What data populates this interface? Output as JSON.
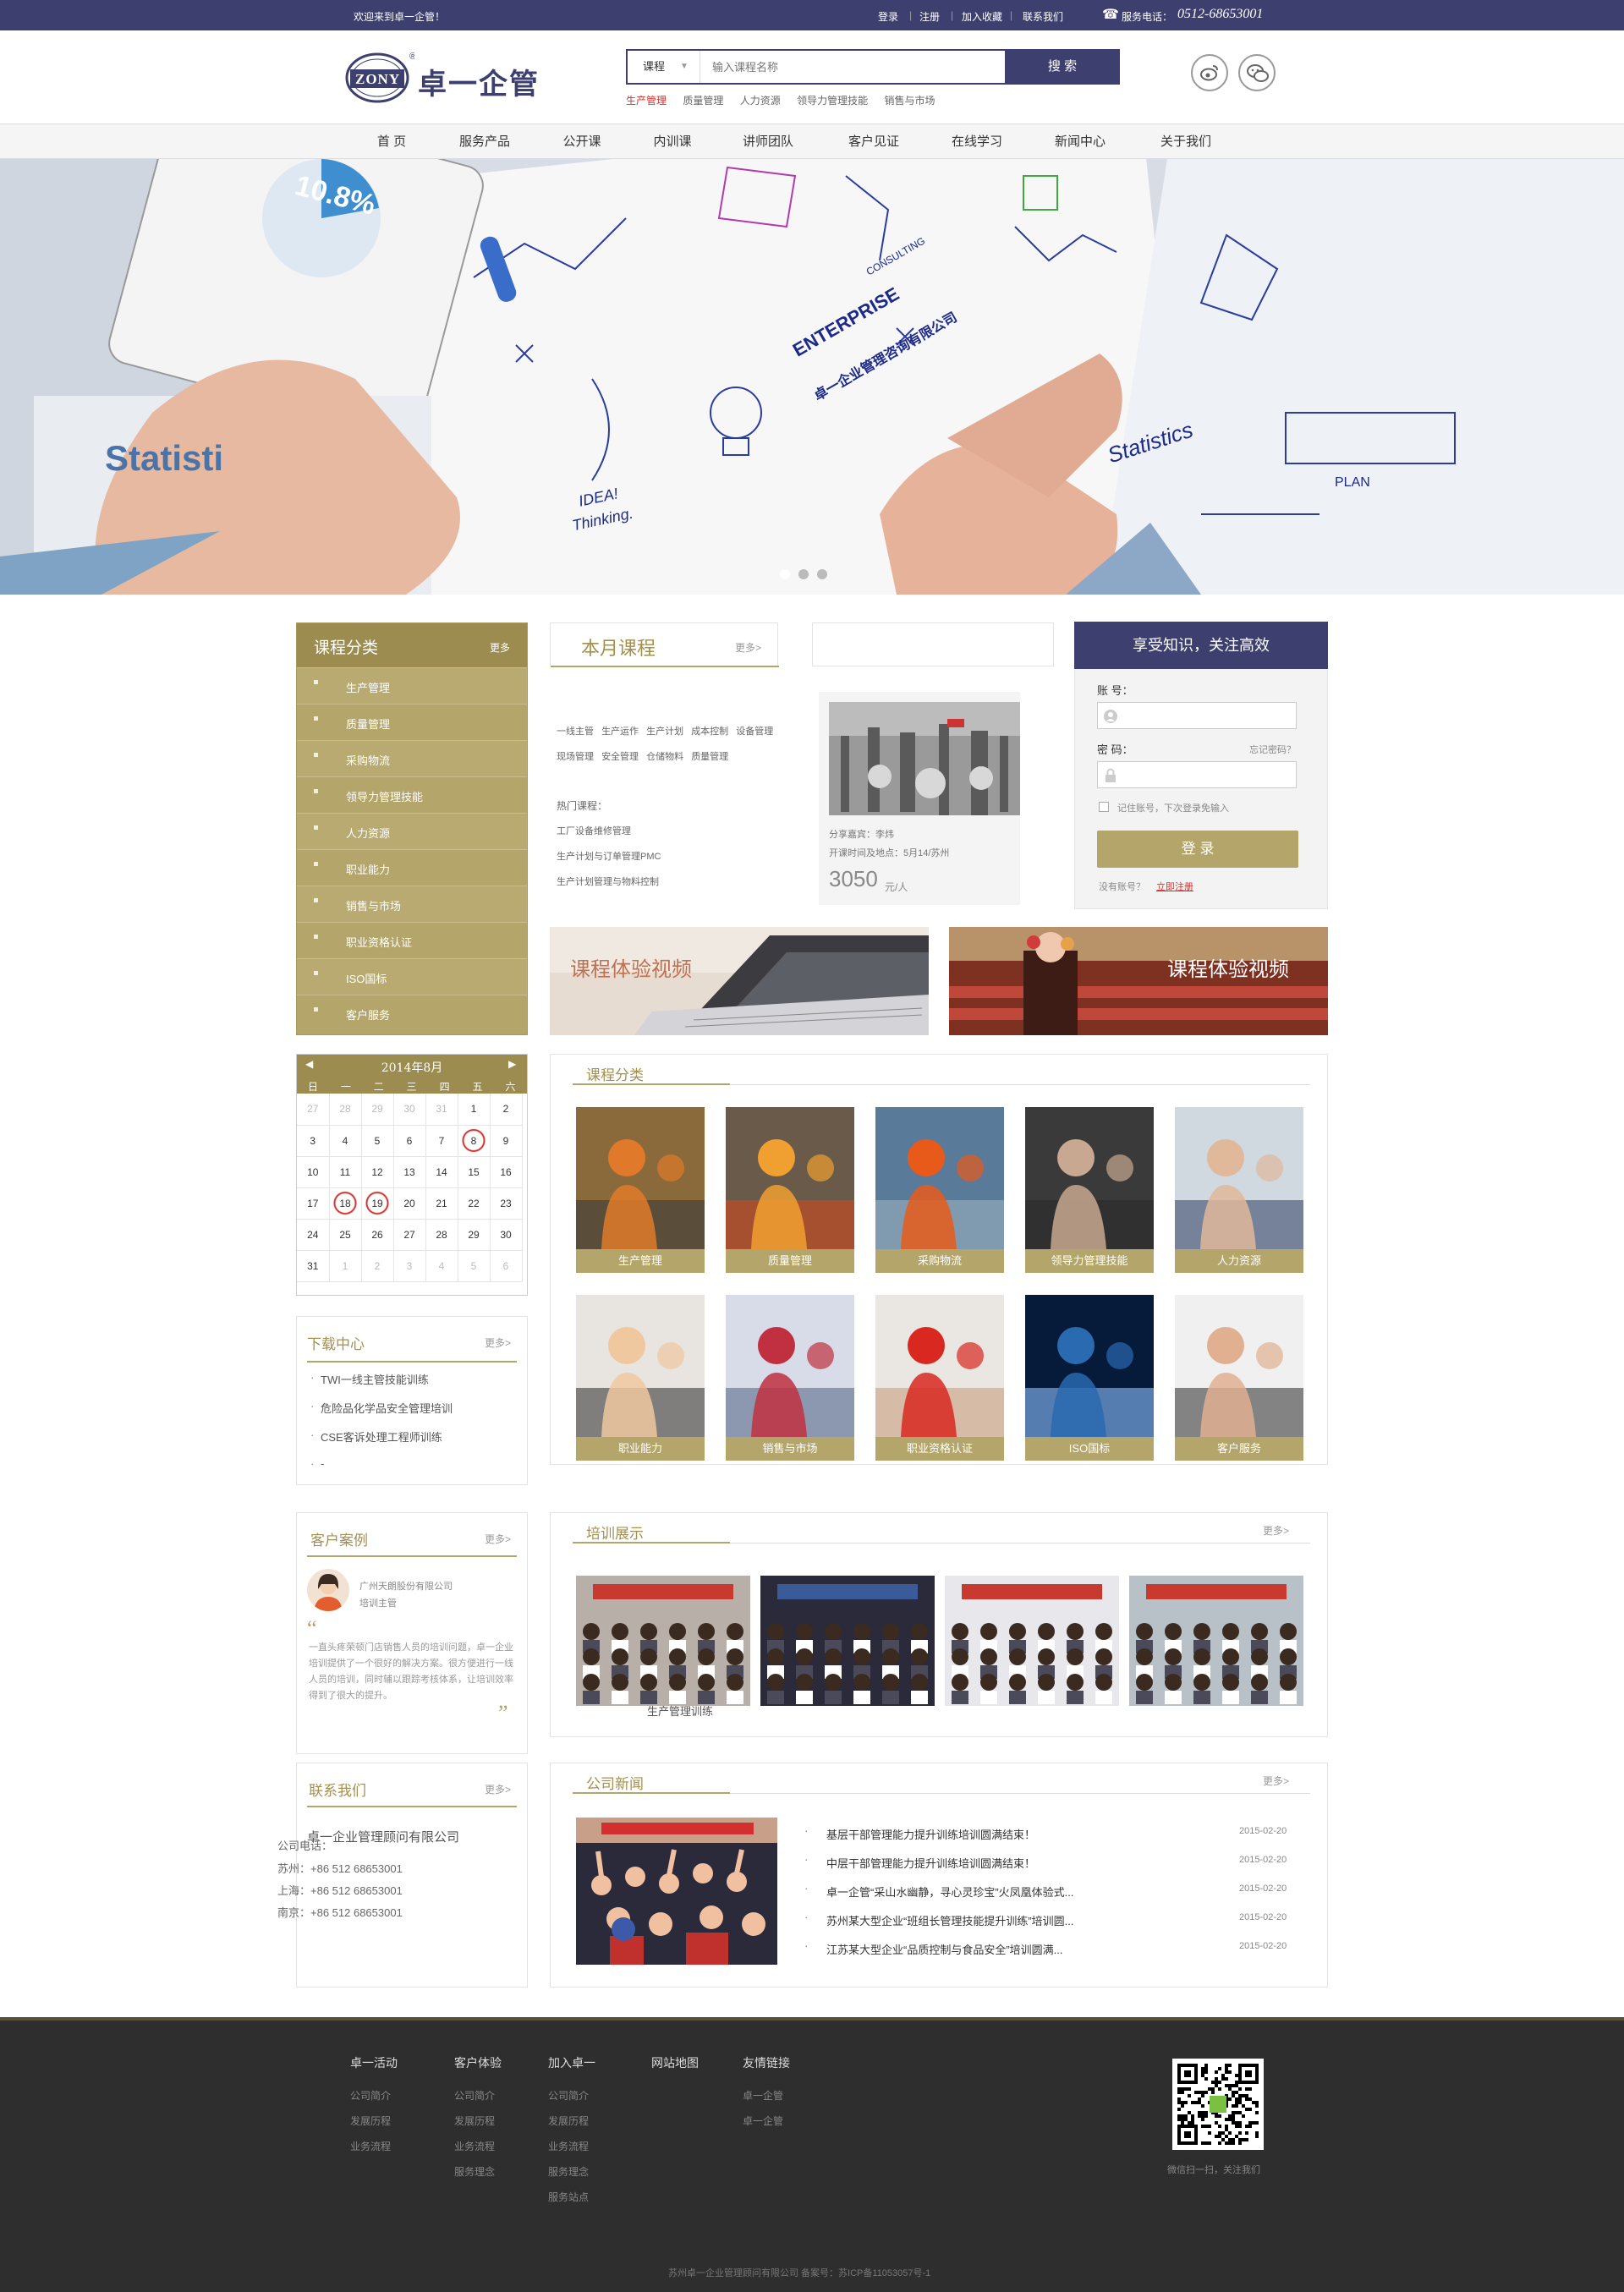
{
  "topbar": {
    "welcome": "欢迎来到卓一企管！",
    "links": [
      "登录",
      "注册",
      "加入收藏",
      "联系我们"
    ],
    "phone_label": "服务电话：",
    "phone": "0512-68653001"
  },
  "header": {
    "logo_en": "ZONY",
    "logo_cn": "卓一企管",
    "search": {
      "category": "课程",
      "placeholder": "输入课程名称",
      "button": "搜 索"
    },
    "hot_keywords": [
      "生产管理",
      "质量管理",
      "人力资源",
      "领导力管理技能",
      "销售与市场"
    ]
  },
  "nav": [
    "首 页",
    "服务产品",
    "公开课",
    "内训课",
    "讲师团队",
    "客户见证",
    "在线学习",
    "新闻中心",
    "关于我们"
  ],
  "hero": {
    "badge": "10.8%",
    "word_statistics": "Statisti",
    "word_enterprise": "ENTERPRISE",
    "word_consulting": "CONSULTING",
    "company_cn": "卓一企业管理咨询有限公司",
    "word_idea": "IDEA!",
    "word_thinking": "Thinking.",
    "word_plan": "PLAN",
    "word_statistics2": "Statistics"
  },
  "sidebar": {
    "title": "课程分类",
    "more": "更多",
    "items": [
      "生产管理",
      "质量管理",
      "采购物流",
      "领导力管理技能",
      "人力资源",
      "职业能力",
      "销售与市场",
      "职业资格认证",
      "ISO国标",
      "客户服务"
    ]
  },
  "calendar": {
    "title": "2014年8月",
    "weekdays": [
      "日",
      "一",
      "二",
      "三",
      "四",
      "五",
      "六"
    ],
    "weeks": [
      [
        "27",
        "28",
        "29",
        "30",
        "31",
        "1",
        "2"
      ],
      [
        "3",
        "4",
        "5",
        "6",
        "7",
        "8",
        "9"
      ],
      [
        "10",
        "11",
        "12",
        "13",
        "14",
        "15",
        "16"
      ],
      [
        "17",
        "18",
        "19",
        "20",
        "21",
        "22",
        "23"
      ],
      [
        "24",
        "25",
        "26",
        "27",
        "28",
        "29",
        "30"
      ],
      [
        "31",
        "1",
        "2",
        "3",
        "4",
        "5",
        "6"
      ]
    ],
    "marked": [
      "8",
      "18",
      "19"
    ]
  },
  "downloads": {
    "title": "下载中心",
    "more": "更多>",
    "items": [
      "TWI一线主管技能训练",
      "危险品化学品安全管理培训",
      "CSE客诉处理工程师训练",
      "-"
    ]
  },
  "cases": {
    "title": "客户案例",
    "more": "更多>",
    "company": "广州天朗股份有限公司",
    "role": "培训主管",
    "quote": "一直头疼荣顿门店销售人员的培训问题，卓一企业培训提供了一个很好的解决方案。很方便进行一线人员的培训，同时辅以跟踪考核体系，让培训效率得到了很大的提升。"
  },
  "contact": {
    "title": "联系我们",
    "more": "更多>",
    "company": "卓一企业管理顾问有限公司",
    "phone_label": "公司电话：",
    "lines": [
      "苏州：+86 512 68653001",
      "上海：+86 512 68653001",
      "南京：+86 512 68653001"
    ]
  },
  "monthly": {
    "title": "本月课程",
    "more": "更多>",
    "tags1": [
      "一线主管",
      "生产运作",
      "生产计划",
      "成本控制",
      "设备管理"
    ],
    "tags2": [
      "现场管理",
      "安全管理",
      "仓储物料",
      "质量管理"
    ],
    "hot_label": "热门课程：",
    "hot": [
      "工厂设备维修管理",
      "生产计划与订单管理PMC",
      "生产计划管理与物料控制"
    ],
    "guest": "分享嘉宾：李炜",
    "time_place": "开课时间及地点：5月14/苏州",
    "price": "3050",
    "unit": "元/人"
  },
  "login": {
    "title": "享受知识，关注高效",
    "account_label": "账 号：",
    "password_label": "密 码：",
    "forgot": "忘记密码？",
    "remember": "记住账号，下次登录免输入",
    "button": "登 录",
    "no_account": "没有账号？",
    "register": "立即注册"
  },
  "banners": [
    "课程体验视频",
    "课程体验视频"
  ],
  "categories": {
    "title": "课程分类",
    "row1": [
      "生产管理",
      "质量管理",
      "采购物流",
      "领导力管理技能",
      "人力资源"
    ],
    "row2": [
      "职业能力",
      "销售与市场",
      "职业资格认证",
      "ISO国标",
      "客户服务"
    ]
  },
  "training": {
    "title": "培训展示",
    "more": "更多>",
    "caption": "生产管理训练"
  },
  "news": {
    "title": "公司新闻",
    "more": "更多>",
    "items": [
      {
        "title": "基层干部管理能力提升训练培训圆满结束！",
        "date": "2015-02-20"
      },
      {
        "title": "中层干部管理能力提升训练培训圆满结束！",
        "date": "2015-02-20"
      },
      {
        "title": "卓一企管“采山水幽静，寻心灵珍宝”火凤凰体验式...",
        "date": "2015-02-20"
      },
      {
        "title": "苏州某大型企业“班组长管理技能提升训练”培训圆...",
        "date": "2015-02-20"
      },
      {
        "title": "江苏某大型企业“品质控制与食品安全”培训圆满...",
        "date": "2015-02-20"
      }
    ]
  },
  "footer": {
    "columns": [
      {
        "title": "卓一活动",
        "links": [
          "公司简介",
          "发展历程",
          "业务流程"
        ]
      },
      {
        "title": "客户体验",
        "links": [
          "公司简介",
          "发展历程",
          "业务流程",
          "服务理念"
        ]
      },
      {
        "title": "加入卓一",
        "links": [
          "公司简介",
          "发展历程",
          "业务流程",
          "服务理念",
          "服务站点"
        ]
      },
      {
        "title": "网站地图",
        "links": []
      },
      {
        "title": "友情链接",
        "links": [
          "卓一企管",
          "卓一企管"
        ]
      }
    ],
    "qr_caption": "微信扫一扫，关注我们",
    "copyright": "苏州卓一企业管理顾问有限公司 备案号：苏ICP备11053057号-1"
  },
  "colors": {
    "navy": "#3d3f6e",
    "gold": "#b4a56a",
    "dark": "#2e2e2e",
    "red": "#d8312b"
  }
}
